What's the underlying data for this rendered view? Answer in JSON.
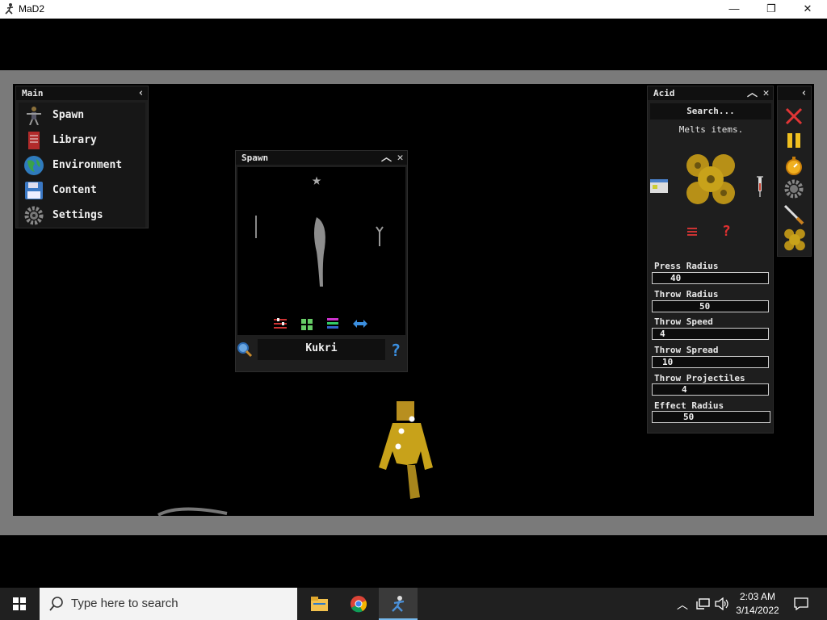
{
  "window": {
    "title": "MaD2",
    "controls": [
      "—",
      "❐",
      "✕"
    ]
  },
  "main_panel": {
    "title": "Main",
    "items": [
      {
        "label": "Spawn",
        "icon": "person-icon"
      },
      {
        "label": "Library",
        "icon": "book-icon"
      },
      {
        "label": "Environment",
        "icon": "globe-icon"
      },
      {
        "label": "Content",
        "icon": "floppy-icon"
      },
      {
        "label": "Settings",
        "icon": "gear-icon"
      }
    ]
  },
  "spawn_panel": {
    "title": "Spawn",
    "selected_item": "Kukri",
    "toolbar_icons": [
      "sliders-icon",
      "grid-icon",
      "layers-icon",
      "swap-icon"
    ]
  },
  "acid_panel": {
    "title": "Acid",
    "search_label": "Search...",
    "description": "Melts items.",
    "fields": [
      {
        "label": "Press Radius",
        "value": "40"
      },
      {
        "label": "Throw Radius",
        "value": "50"
      },
      {
        "label": "Throw Speed",
        "value": "4"
      },
      {
        "label": "Throw Spread",
        "value": "10"
      },
      {
        "label": "Throw Projectiles",
        "value": "4"
      },
      {
        "label": "Effect Radius",
        "value": "50"
      }
    ]
  },
  "side_toolbar": [
    "close-icon",
    "pause-icon",
    "stopwatch-icon",
    "gear-icon",
    "knife-icon",
    "acid-icon"
  ],
  "taskbar": {
    "search_placeholder": "Type here to search",
    "time": "2:03 AM",
    "date": "3/14/2022"
  },
  "colors": {
    "accent": "#3b6fd6",
    "gold": "#c8a21a",
    "panel": "#1e1e1e"
  }
}
